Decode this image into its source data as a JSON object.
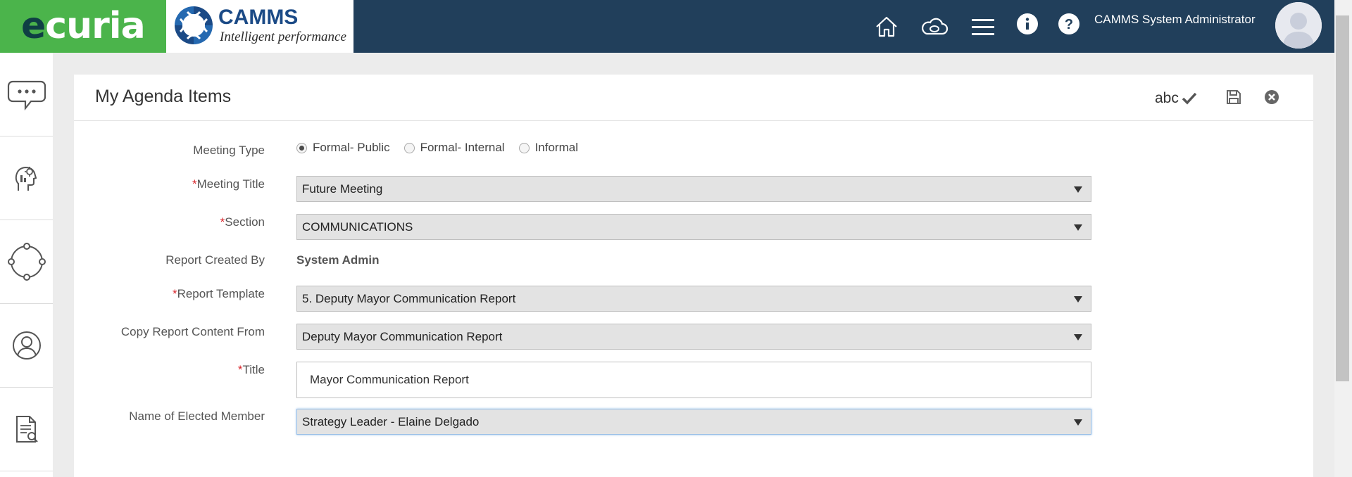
{
  "header": {
    "brand_ecuria": {
      "part1": "e",
      "part2": "curia"
    },
    "brand_camms": {
      "name": "CAMMS",
      "tagline": "Intelligent performance"
    },
    "user_name": "CAMMS System Administrator",
    "icons": [
      "home-icon",
      "cloud-sync-icon",
      "menu-icon",
      "info-icon",
      "help-icon",
      "avatar"
    ]
  },
  "leftnav": {
    "items": [
      "chat-icon",
      "settings-head-icon",
      "cycle-icon",
      "user-circle-icon",
      "document-search-icon"
    ]
  },
  "page": {
    "title": "My Agenda Items",
    "toolbar": {
      "spell_check_label": "abc"
    }
  },
  "form": {
    "meeting_type": {
      "label": "Meeting Type",
      "options": [
        "Formal- Public",
        "Formal- Internal",
        "Informal"
      ],
      "selected": "Formal- Public"
    },
    "meeting_title": {
      "label": "Meeting Title",
      "required_mark": "*",
      "value": "Future Meeting"
    },
    "section": {
      "label": "Section",
      "required_mark": "*",
      "value": "COMMUNICATIONS"
    },
    "report_created_by": {
      "label": "Report Created By",
      "value": "System Admin"
    },
    "report_template": {
      "label": "Report Template",
      "required_mark": "*",
      "value": "5. Deputy Mayor Communication Report"
    },
    "copy_report_content_from": {
      "label": "Copy Report Content From",
      "value": "Deputy Mayor Communication Report"
    },
    "title": {
      "label": "Title",
      "required_mark": "*",
      "value": "Mayor Communication Report"
    },
    "elected_member": {
      "label": "Name of Elected Member",
      "value": "Strategy Leader - Elaine Delgado"
    }
  },
  "colors": {
    "header_bg": "#213f5b",
    "ecuria_green": "#4bb44b",
    "required_red": "#d9252b",
    "select_bg": "#e3e3e3"
  }
}
